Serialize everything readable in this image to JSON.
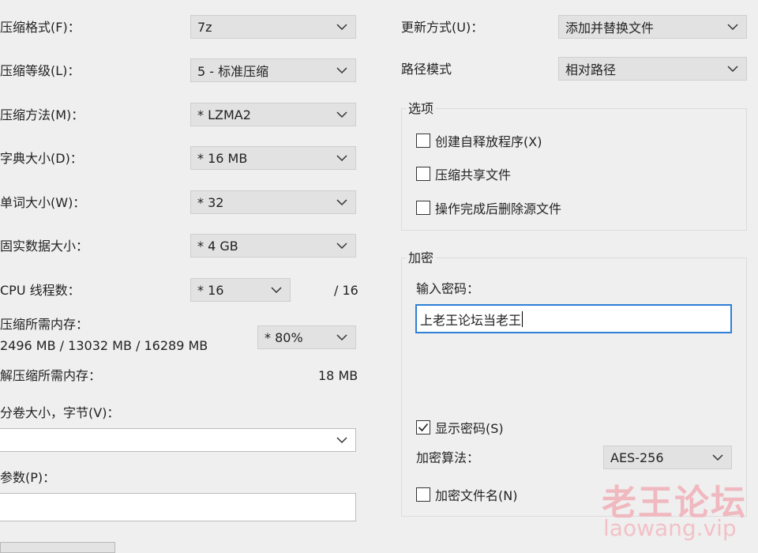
{
  "left": {
    "format_label": "压缩格式(F)：",
    "format_value": "7z",
    "level_label": "压缩等级(L)：",
    "level_value": "5 - 标准压缩",
    "method_label": "压缩方法(M)：",
    "method_value": "* LZMA2",
    "dict_label": "字典大小(D)：",
    "dict_value": "* 16 MB",
    "word_label": "单词大小(W)：",
    "word_value": "* 32",
    "solid_label": "固实数据大小：",
    "solid_value": "* 4 GB",
    "threads_label": "CPU 线程数：",
    "threads_value": "* 16",
    "threads_total": "/ 16",
    "mem_label": "压缩所需内存：",
    "mem_detail": "2496 MB / 13032 MB / 16289 MB",
    "mem_value": "* 80%",
    "decomp_label": "解压缩所需内存：",
    "decomp_value": "18 MB",
    "volume_label": "分卷大小，字节(V)：",
    "volume_value": "",
    "params_label": "参数(P)：",
    "params_value": ""
  },
  "right": {
    "update_label": "更新方式(U)：",
    "update_value": "添加并替换文件",
    "path_label": "路径模式",
    "path_value": "相对路径",
    "options_title": "选项",
    "opt_sfx": "创建自释放程序(X)",
    "opt_shared": "压缩共享文件",
    "opt_delete": "操作完成后删除源文件",
    "encrypt_title": "加密",
    "password_label": "输入密码：",
    "password_value": "上老王论坛当老王",
    "show_password": "显示密码(S)",
    "algo_label": "加密算法：",
    "algo_value": "AES-256",
    "encrypt_names": "加密文件名(N)"
  },
  "checks": {
    "opt_sfx": false,
    "opt_shared": false,
    "opt_delete": false,
    "show_password": true,
    "encrypt_names": false
  },
  "watermark": {
    "name": "老王论坛",
    "url": "laowang.vip"
  },
  "icons": {
    "dropdown": "chevron-down-icon",
    "check": "checkmark-icon"
  }
}
